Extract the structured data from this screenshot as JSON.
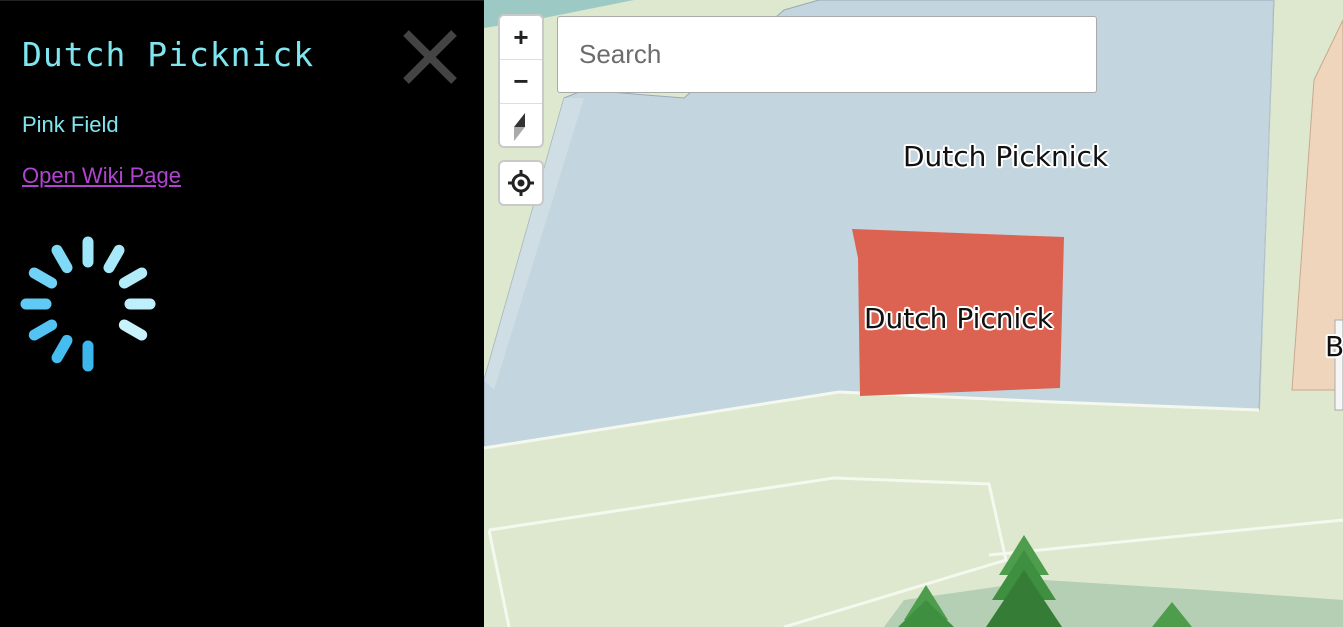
{
  "sidebar": {
    "title": "Dutch Picknick",
    "subtitle": "Pink Field",
    "wiki_link": "Open Wiki Page",
    "loading": true
  },
  "map": {
    "search": {
      "placeholder": "Search",
      "value": ""
    },
    "controls": {
      "zoom_in": "+",
      "zoom_out": "−"
    },
    "labels": {
      "area": "Dutch Picknick",
      "building": "Dutch Picnick",
      "edge_partial": "B"
    },
    "colors": {
      "grass": "#dde8cf",
      "area_fill": "#c3d5de",
      "building_fill": "#dc6251",
      "water": "#9dc9c5",
      "accent_text": "#7fe6f0",
      "link": "#b044d0"
    }
  }
}
